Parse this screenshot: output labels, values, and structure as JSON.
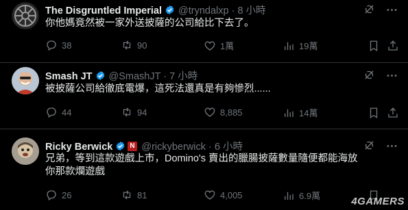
{
  "tweets": [
    {
      "name": "The Disgruntled Imperial",
      "handle": "@tryndalxp",
      "sep": "·",
      "time": "8 小時",
      "text": "你他媽竟然被一家外送披薩的公司給比下去了。",
      "replies": "38",
      "retweets": "90",
      "likes": "1萬",
      "views": "19萬",
      "avatar_icon": "imperial-crest-icon"
    },
    {
      "name": "Smash JT",
      "handle": "@SmashJT",
      "sep": "·",
      "time": "7 小時",
      "text": "被披薩公司給徹底電爆，這死法還真是有夠慘烈......",
      "replies": "44",
      "retweets": "94",
      "likes": "8,885",
      "views": "14萬",
      "avatar_icon": "user-photo-icon"
    },
    {
      "name": "Ricky Berwick",
      "handle": "@rickyberwick",
      "sep": "·",
      "time": "6 小時",
      "text": "兄弟，等到這款遊戲上市，Domino's 賣出的臘腸披薩數量隨便都能海放你那款爛遊戲",
      "replies": "26",
      "retweets": "81",
      "likes": "4,005",
      "views": "6.9萬",
      "avatar_icon": "user-photo-icon",
      "badge_icon": "netflix-badge-icon",
      "badge_letter": "N"
    }
  ],
  "watermark": "4GAMERS",
  "colors": {
    "background": "#000000",
    "text": "#e7e9ea",
    "muted": "#71767b",
    "verified": "#1d9bf0",
    "divider": "#2f3336"
  }
}
